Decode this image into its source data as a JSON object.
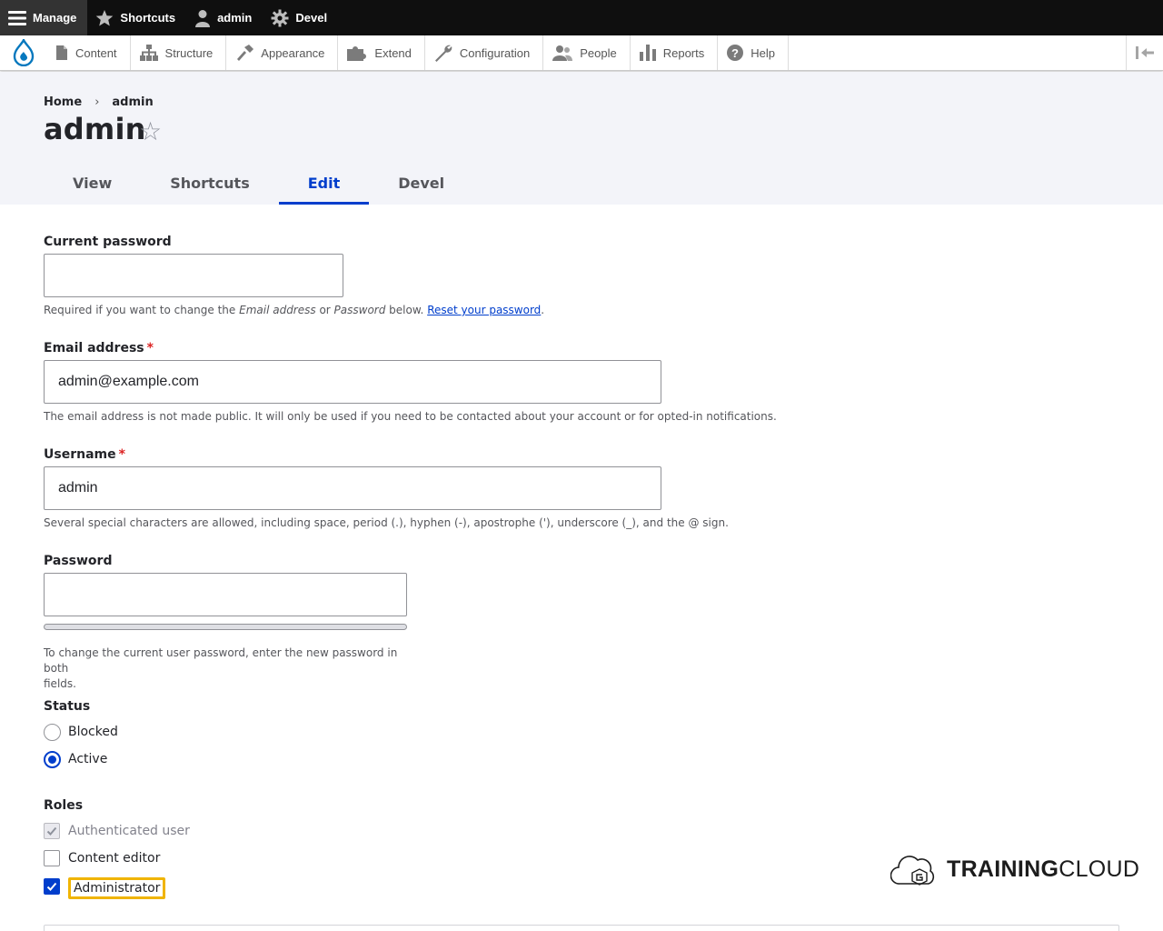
{
  "toolbar": {
    "items": [
      {
        "label": "Manage",
        "icon": "menu-icon"
      },
      {
        "label": "Shortcuts",
        "icon": "star-icon"
      },
      {
        "label": "admin",
        "icon": "user-icon"
      },
      {
        "label": "Devel",
        "icon": "gear-icon"
      }
    ]
  },
  "tray": {
    "items": [
      {
        "label": "Content",
        "icon": "page-icon"
      },
      {
        "label": "Structure",
        "icon": "sitemap-icon"
      },
      {
        "label": "Appearance",
        "icon": "paintbrush-icon"
      },
      {
        "label": "Extend",
        "icon": "puzzle-icon"
      },
      {
        "label": "Configuration",
        "icon": "wrench-icon"
      },
      {
        "label": "People",
        "icon": "people-icon"
      },
      {
        "label": "Reports",
        "icon": "bar-chart-icon"
      },
      {
        "label": "Help",
        "icon": "help-icon"
      }
    ]
  },
  "breadcrumb": {
    "home": "Home",
    "separator": "›",
    "current": "admin"
  },
  "page": {
    "title": "admin",
    "star": "☆"
  },
  "tabs": [
    {
      "label": "View",
      "active": false
    },
    {
      "label": "Shortcuts",
      "active": false
    },
    {
      "label": "Edit",
      "active": true
    },
    {
      "label": "Devel",
      "active": false
    }
  ],
  "form": {
    "current_password": {
      "label": "Current password",
      "value": "",
      "desc_prefix": "Required if you want to change the ",
      "desc_em1": "Email address",
      "desc_or": " or ",
      "desc_em2": "Password",
      "desc_below": " below. ",
      "desc_link": "Reset your password",
      "desc_end": "."
    },
    "email": {
      "label": "Email address",
      "required_mark": "*",
      "value": "admin@example.com",
      "desc": "The email address is not made public. It will only be used if you need to be contacted about your account or for opted-in notifications."
    },
    "username": {
      "label": "Username",
      "required_mark": "*",
      "value": "admin",
      "desc": "Several special characters are allowed, including space, period (.), hyphen (-), apostrophe ('), underscore (_), and the @ sign."
    },
    "password": {
      "label": "Password",
      "value": "",
      "desc_line1": "To change the current user password, enter the new password in both",
      "desc_line2": "fields."
    },
    "status": {
      "label": "Status",
      "options": [
        {
          "label": "Blocked",
          "checked": false
        },
        {
          "label": "Active",
          "checked": true
        }
      ]
    },
    "roles": {
      "label": "Roles",
      "options": [
        {
          "label": "Authenticated user",
          "checked": true,
          "disabled": true
        },
        {
          "label": "Content editor",
          "checked": false,
          "disabled": false
        },
        {
          "label": "Administrator",
          "checked": true,
          "disabled": false,
          "focused": true
        }
      ]
    }
  },
  "brand": {
    "bold": "TRAINING",
    "light": "CLOUD"
  },
  "colors": {
    "accent": "#003ecc",
    "toolbar_bg": "#0f0f0f",
    "header_bg": "#f3f4f9",
    "required": "#dc2323",
    "focus_ring": "#ffb800"
  }
}
